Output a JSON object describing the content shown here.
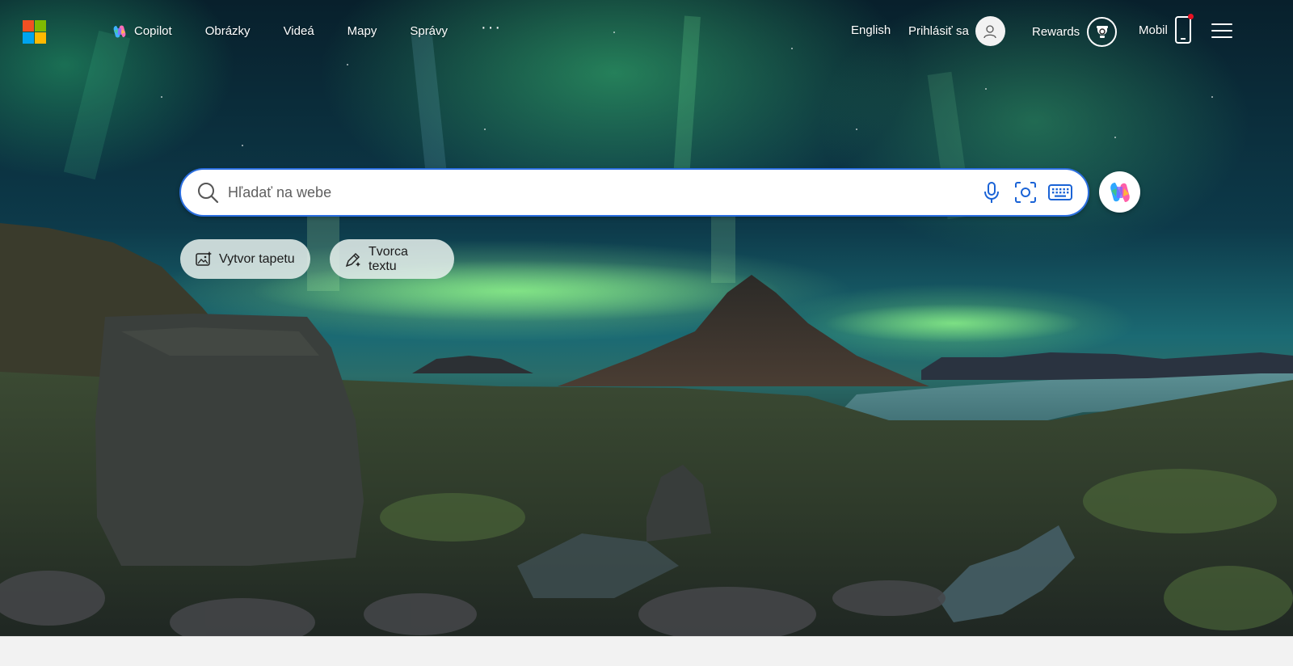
{
  "header": {
    "logo_colors": [
      "#f25022",
      "#7fba00",
      "#00a4ef",
      "#ffb900"
    ],
    "nav": [
      {
        "label": "Copilot",
        "icon": "copilot-icon"
      },
      {
        "label": "Obrázky"
      },
      {
        "label": "Videá"
      },
      {
        "label": "Mapy"
      },
      {
        "label": "Správy"
      }
    ],
    "more_label": "···",
    "language": "English",
    "signin_label": "Prihlásiť sa",
    "rewards_label": "Rewards",
    "mobile_label": "Mobil"
  },
  "search": {
    "placeholder": "Hľadať na webe",
    "accent_color": "#2c6fe0",
    "tools": [
      "microphone-icon",
      "visual-search-icon",
      "keyboard-icon"
    ]
  },
  "chips": [
    {
      "label": "Vytvor tapetu",
      "icon": "image-create-icon"
    },
    {
      "label": "Tvorca textu",
      "icon": "pen-sparkle-icon"
    }
  ],
  "background": {
    "scene": "aurora-over-mountain"
  }
}
